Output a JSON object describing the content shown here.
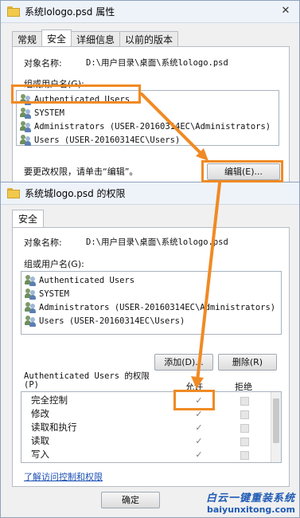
{
  "props_window": {
    "title": "系统lologo.psd 属性",
    "close_glyph": "✕",
    "tabs": [
      "常规",
      "安全",
      "详细信息",
      "以前的版本"
    ],
    "active_tab": "安全",
    "object_name_label": "对象名称:",
    "object_name_value": "D:\\用户目录\\桌面\\系统lologo.psd",
    "group_label": "组或用户名(G):",
    "users": [
      "Authenticated Users",
      "SYSTEM",
      "Administrators (USER-20160314EC\\Administrators)",
      "Users (USER-20160314EC\\Users)"
    ],
    "change_hint": "要更改权限，请单击“编辑”。",
    "edit_button": "编辑(E)..."
  },
  "perm_window": {
    "title": "系统城logo.psd 的权限",
    "close_glyph": "✕",
    "tab": "安全",
    "object_name_label": "对象名称:",
    "object_name_value": "D:\\用户目录\\桌面\\系统lologo.psd",
    "group_label": "组或用户名(G):",
    "users": [
      "Authenticated Users",
      "SYSTEM",
      "Administrators (USER-20160314EC\\Administrators)",
      "Users (USER-20160314EC\\Users)"
    ],
    "add_button": "添加(D)...",
    "remove_button": "删除(R)",
    "perm_header_line1": "Authenticated Users 的权限",
    "perm_header_line2": "(P)",
    "allow_header": "允许",
    "deny_header": "拒绝",
    "permissions": [
      {
        "name": "完全控制",
        "allow": true,
        "deny": false
      },
      {
        "name": "修改",
        "allow": true,
        "deny": false
      },
      {
        "name": "读取和执行",
        "allow": true,
        "deny": false
      },
      {
        "name": "读取",
        "allow": true,
        "deny": false
      },
      {
        "name": "写入",
        "allow": true,
        "deny": false
      }
    ],
    "learn_link": "了解访问控制和权限",
    "ok_button": "确定",
    "check_glyph": "✓"
  },
  "watermark": {
    "line1": "白云一键重装系统",
    "line2": "baiyunxitong.com"
  },
  "colors": {
    "highlight": "#f08a24",
    "watermark_blue": "#1e5ab4",
    "link": "#1a4fb3"
  }
}
